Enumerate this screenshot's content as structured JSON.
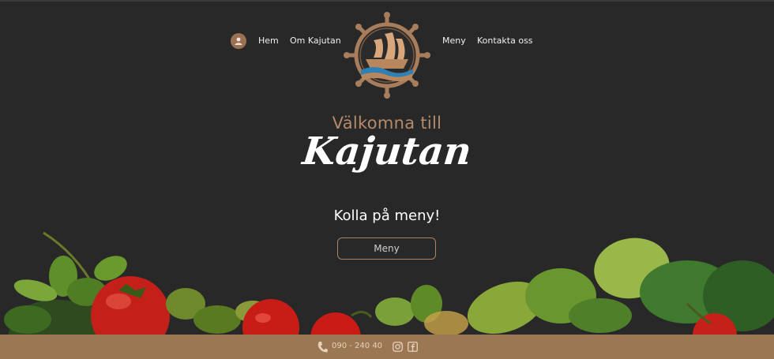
{
  "nav": {
    "links_left": [
      "Hem",
      "Om Kajutan"
    ],
    "links_right": [
      "Meny",
      "Kontakta oss"
    ]
  },
  "hero": {
    "subtitle": "Välkomna till",
    "title": "Kajutan",
    "cta_text": "Kolla på meny!",
    "button_label": "Meny"
  },
  "footer": {
    "phone": "090 - 240 40"
  },
  "colors": {
    "background": "#282828",
    "accent": "#b48a6a",
    "footer": "#9c7753"
  },
  "icons": [
    "user-icon",
    "ship-wheel-logo",
    "phone-icon",
    "instagram-icon",
    "facebook-icon"
  ]
}
